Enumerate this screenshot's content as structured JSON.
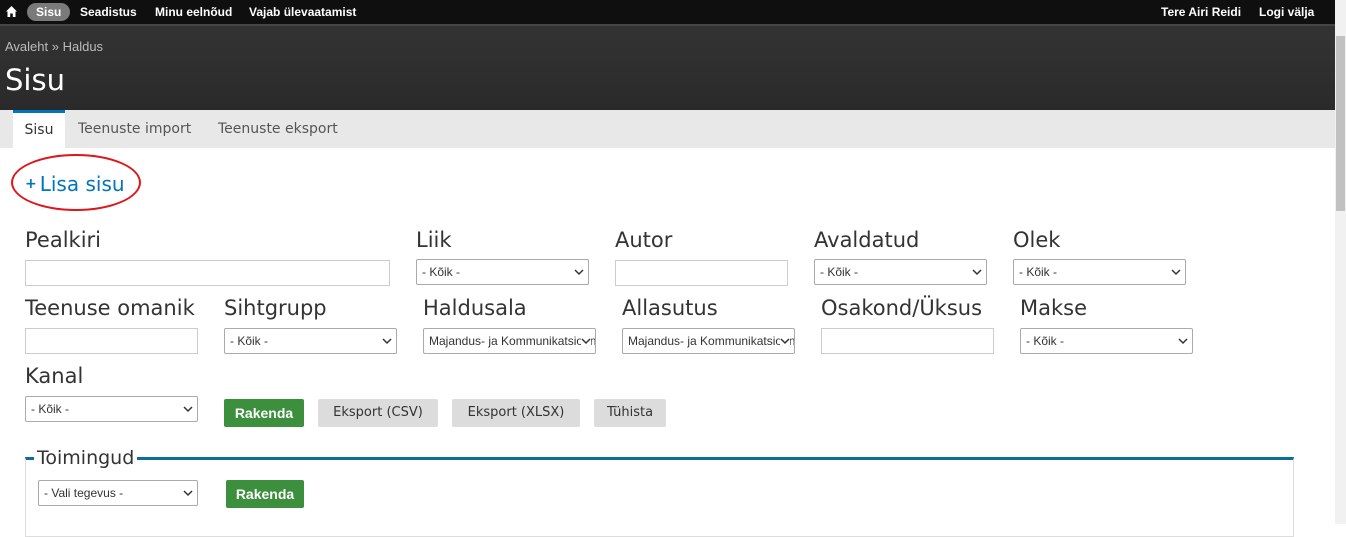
{
  "toolbar": {
    "items": [
      "Sisu",
      "Seadistus",
      "Minu eelnõud",
      "Vajab ülevaatamist"
    ],
    "greeting": "Tere",
    "user": "Airi Reidi",
    "logout": "Logi välja"
  },
  "breadcrumb": "Avaleht » Haldus",
  "page_title": "Sisu",
  "tabs": [
    "Sisu",
    "Teenuste import",
    "Teenuste eksport"
  ],
  "add_link": "Lisa sisu",
  "filters": {
    "title_label": "Pealkiri",
    "type_label": "Liik",
    "type_value": "- Kõik -",
    "author_label": "Autor",
    "published_label": "Avaldatud",
    "published_value": "- Kõik -",
    "status_label": "Olek",
    "status_value": "- Kõik -",
    "owner_label": "Teenuse omanik",
    "audience_label": "Sihtgrupp",
    "audience_value": "- Kõik -",
    "domain_label": "Haldusala",
    "domain_value": "Majandus- ja Kommunikatsiooniministeerium",
    "agency_label": "Allasutus",
    "agency_value": "Majandus- ja Kommunikatsiooniministeerium",
    "department_label": "Osakond/Üksus",
    "payment_label": "Makse",
    "payment_value": "- Kõik -",
    "channel_label": "Kanal",
    "channel_value": "- Kõik -"
  },
  "buttons": {
    "apply": "Rakenda",
    "export_csv": "Eksport (CSV)",
    "export_xlsx": "Eksport (XLSX)",
    "cancel": "Tühista"
  },
  "actions": {
    "legend": "Toimingud",
    "select_value": "- Vali tegevus -",
    "apply": "Rakenda"
  },
  "colors": {
    "accent": "#0074bd",
    "apply_green": "#3c8f3c",
    "highlight_red": "#e0151b"
  }
}
